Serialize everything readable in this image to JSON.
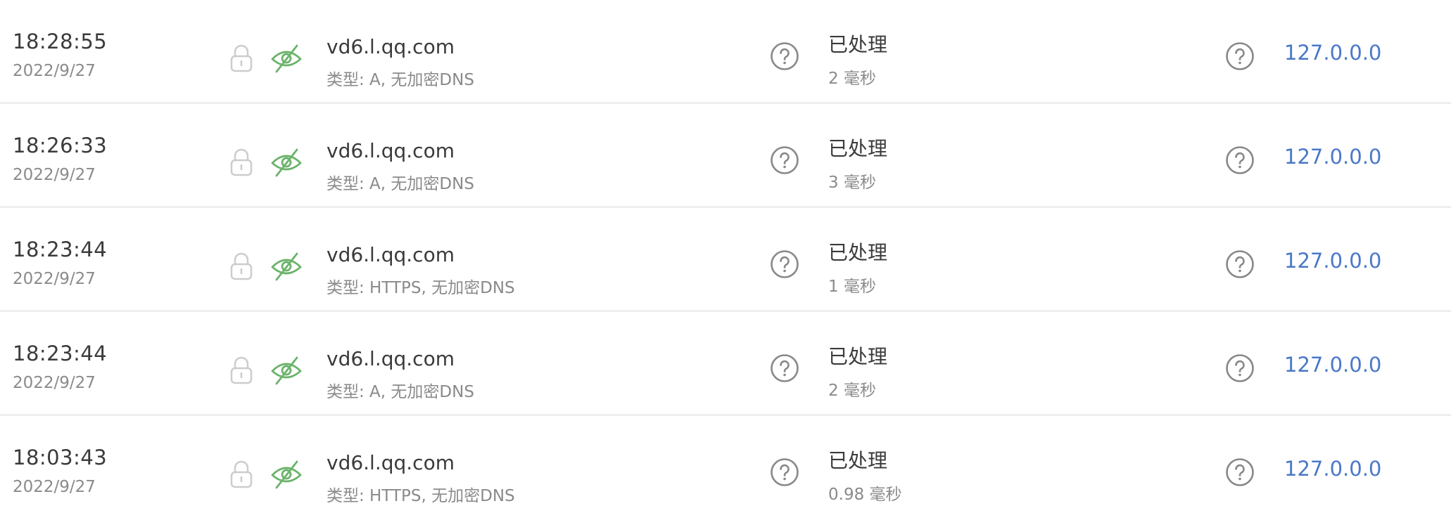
{
  "colors": {
    "accent_link": "#4a78c9",
    "eye_icon_green": "#6bb36b",
    "lock_icon_gray": "#cccccc",
    "help_icon_gray": "#888888",
    "divider": "#eeeeee"
  },
  "icons": {
    "lock": "lock-icon",
    "eye_slash": "eye-slash-icon",
    "help": "question-circle-icon"
  },
  "rows": [
    {
      "time": "18:28:55",
      "date": "2022/9/27",
      "domain": "vd6.l.qq.com",
      "dns_type": "类型: A, 无加密DNS",
      "status": "已处理",
      "elapsed": "2 毫秒",
      "response": "127.0.0.0"
    },
    {
      "time": "18:26:33",
      "date": "2022/9/27",
      "domain": "vd6.l.qq.com",
      "dns_type": "类型: A, 无加密DNS",
      "status": "已处理",
      "elapsed": "3 毫秒",
      "response": "127.0.0.0"
    },
    {
      "time": "18:23:44",
      "date": "2022/9/27",
      "domain": "vd6.l.qq.com",
      "dns_type": "类型: HTTPS, 无加密DNS",
      "status": "已处理",
      "elapsed": "1 毫秒",
      "response": "127.0.0.0"
    },
    {
      "time": "18:23:44",
      "date": "2022/9/27",
      "domain": "vd6.l.qq.com",
      "dns_type": "类型: A, 无加密DNS",
      "status": "已处理",
      "elapsed": "2 毫秒",
      "response": "127.0.0.0"
    },
    {
      "time": "18:03:43",
      "date": "2022/9/27",
      "domain": "vd6.l.qq.com",
      "dns_type": "类型: HTTPS, 无加密DNS",
      "status": "已处理",
      "elapsed": "0.98 毫秒",
      "response": "127.0.0.0"
    }
  ]
}
